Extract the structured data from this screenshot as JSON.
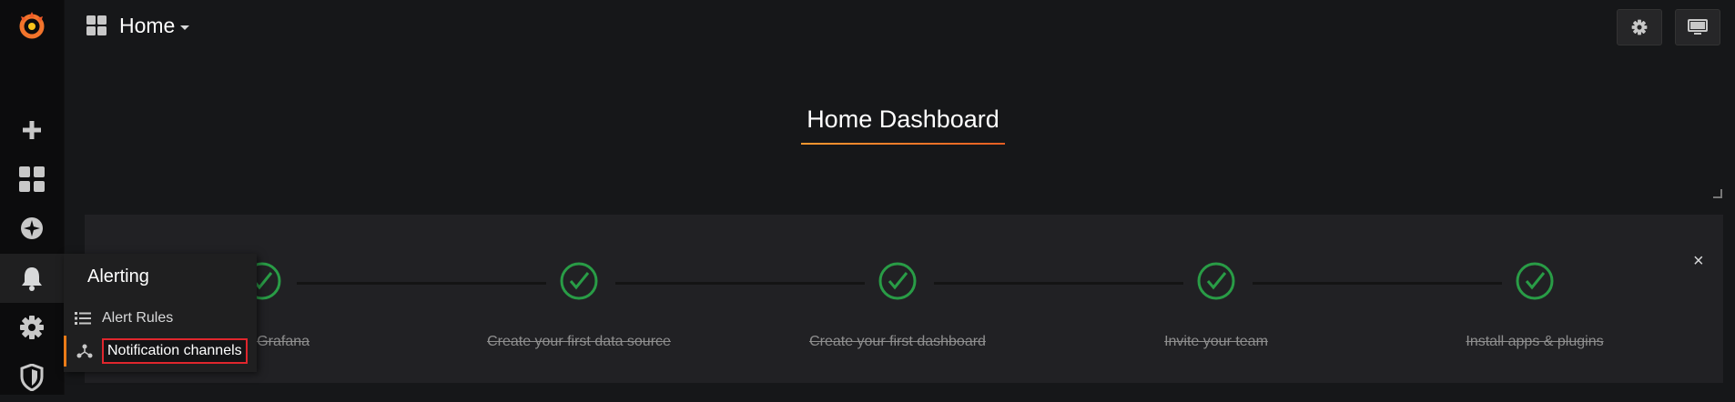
{
  "topbar": {
    "title": "Home"
  },
  "dashboard": {
    "title": "Home Dashboard"
  },
  "steps": [
    {
      "label": "Install Grafana",
      "done": true
    },
    {
      "label": "Create your first data source",
      "done": true
    },
    {
      "label": "Create your first dashboard",
      "done": true
    },
    {
      "label": "Invite your team",
      "done": true
    },
    {
      "label": "Install apps & plugins",
      "done": true
    }
  ],
  "flyout": {
    "title": "Alerting",
    "items": [
      {
        "label": "Alert Rules"
      },
      {
        "label": "Notification channels"
      }
    ]
  },
  "icons": {
    "sidebar": [
      "grafana-logo-icon",
      "plus-icon",
      "dashboards-icon",
      "compass-icon",
      "bell-icon",
      "gear-icon",
      "shield-icon"
    ],
    "topbar": [
      "grid-icon",
      "gear-icon",
      "monitor-icon"
    ]
  },
  "colors": {
    "accent": "#eb7b18",
    "check": "#299c46",
    "highlight": "#e0262d"
  }
}
